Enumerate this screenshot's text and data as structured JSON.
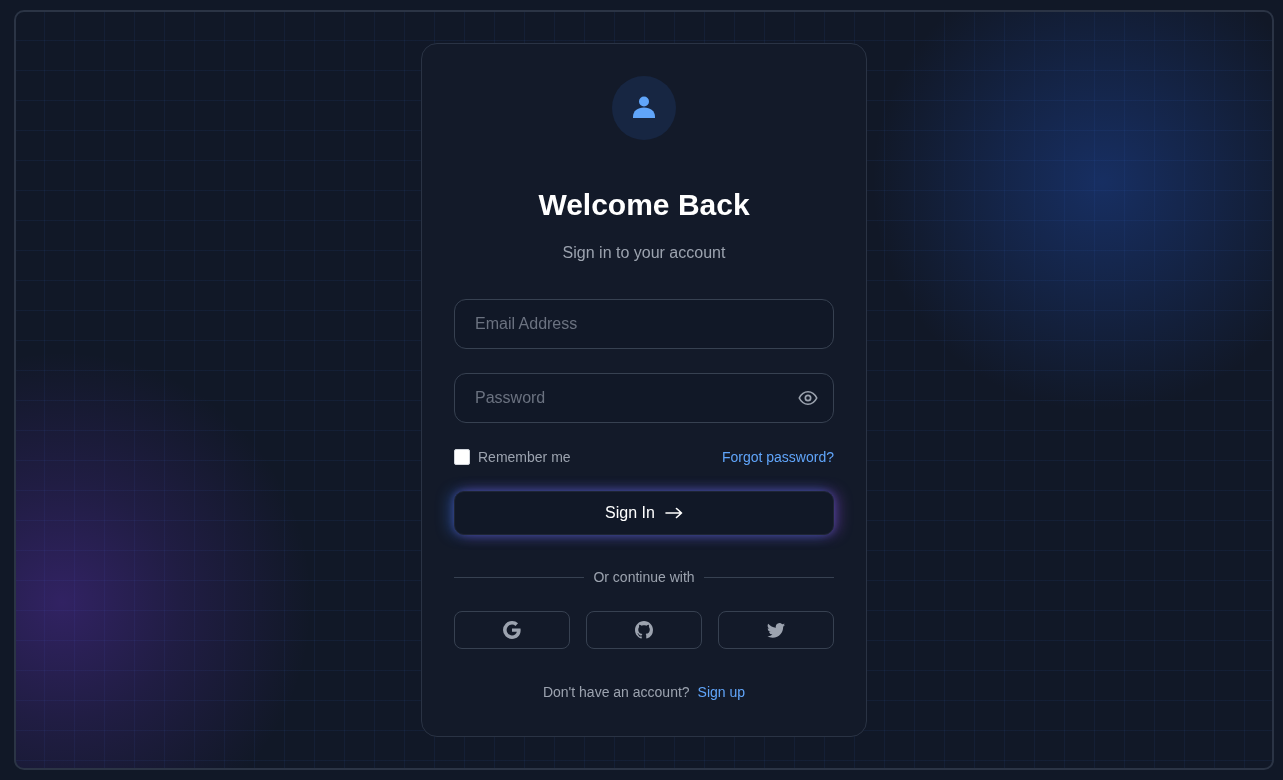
{
  "header": {
    "title": "Welcome Back",
    "subtitle": "Sign in to your account"
  },
  "fields": [
    {
      "kind": "email",
      "placeholder": "Email Address"
    },
    {
      "kind": "password",
      "placeholder": "Password"
    }
  ],
  "remember": {
    "label": "Remember me",
    "checked": false
  },
  "forgot_link": "Forgot password?",
  "submit": {
    "label": "Sign In"
  },
  "divider": "Or continue with",
  "social_buttons": [
    {
      "kind": "google"
    },
    {
      "kind": "github"
    },
    {
      "kind": "twitter"
    }
  ],
  "footer": {
    "text": "Don't have an account?",
    "link": "Sign up"
  }
}
